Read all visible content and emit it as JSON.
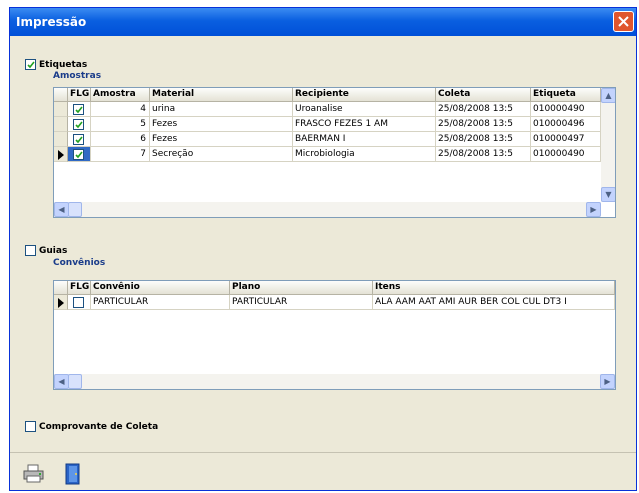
{
  "window": {
    "title": "Impressão"
  },
  "etiquetas": {
    "label": "Etiquetas",
    "checked": true,
    "amostras_label": "Amostras",
    "columns": [
      "FLG",
      "Amostra",
      "Material",
      "Recipiente",
      "Coleta",
      "Etiqueta"
    ],
    "rows": [
      {
        "flg": true,
        "amostra": "4",
        "material": "urina",
        "recipiente": "Uroanalise",
        "coleta": "25/08/2008 13:5",
        "etiqueta": "010000490"
      },
      {
        "flg": true,
        "amostra": "5",
        "material": "Fezes",
        "recipiente": "FRASCO FEZES 1 AM",
        "coleta": "25/08/2008 13:5",
        "etiqueta": "010000496"
      },
      {
        "flg": true,
        "amostra": "6",
        "material": "Fezes",
        "recipiente": "BAERMAN I",
        "coleta": "25/08/2008 13:5",
        "etiqueta": "010000497"
      },
      {
        "flg": true,
        "amostra": "7",
        "material": "Secreção",
        "recipiente": "Microbiologia",
        "coleta": "25/08/2008 13:5",
        "etiqueta": "010000490",
        "current": true
      }
    ]
  },
  "guias": {
    "label": "Guias",
    "checked": false,
    "convenios_label": "Convênios",
    "columns": [
      "FLG",
      "Convênio",
      "Plano",
      "Itens"
    ],
    "rows": [
      {
        "flg": false,
        "convenio": "PARTICULAR",
        "plano": "PARTICULAR",
        "itens": "ALA AAM AAT AMI AUR BER COL CUL DT3 I",
        "current": true
      }
    ]
  },
  "comprovante": {
    "label": "Comprovante de Coleta",
    "checked": false
  },
  "toolbar": {
    "icons": [
      "printer-icon",
      "exit-door-icon"
    ]
  },
  "colors": {
    "title_bar": "#0a5fe0",
    "section_blue": "#1a3c8a",
    "window_bg": "#ece9d8"
  }
}
